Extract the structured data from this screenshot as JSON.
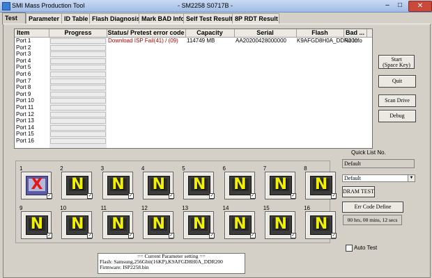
{
  "window": {
    "title": "SMI Mass Production Tool",
    "center_title": "- SM2258 S0717B -",
    "minimize": "–",
    "maximize": "□",
    "close": "✕"
  },
  "tabs": [
    "Test",
    "Parameter",
    "ID Table",
    "Flash Diagnosis",
    "Mark BAD Info",
    "Self Test Result",
    "8P RDT Result"
  ],
  "list": {
    "headers": [
      "Item",
      "Progress",
      "Status/ Pretest error code",
      "Capacity",
      "Serial",
      "Flash",
      "Bad ..."
    ],
    "rows": [
      {
        "item": "Port 1",
        "status": "Download ISP Fail(41) / (09)",
        "capacity": "114749 MB",
        "serial": "AA20200428000000",
        "flash": "K9AFGD8H0A_DDR200",
        "bad": "No Info"
      },
      {
        "item": "Port 2"
      },
      {
        "item": "Port 3"
      },
      {
        "item": "Port 4"
      },
      {
        "item": "Port 5"
      },
      {
        "item": "Port 6"
      },
      {
        "item": "Port 7"
      },
      {
        "item": "Port 8"
      },
      {
        "item": "Port 9"
      },
      {
        "item": "Port 10"
      },
      {
        "item": "Port 11"
      },
      {
        "item": "Port 12"
      },
      {
        "item": "Port 13"
      },
      {
        "item": "Port 14"
      },
      {
        "item": "Port 15"
      },
      {
        "item": "Port 16"
      }
    ]
  },
  "buttons": {
    "start_line1": "Start",
    "start_line2": "(Space Key)",
    "quit": "Quit",
    "scan_drive": "Scan Drive",
    "debug": "Debug",
    "dram_test": "DRAM TEST",
    "err_code_define": "Err Code Define"
  },
  "quick_list": {
    "label": "Quick List No.",
    "value": "Default",
    "combo_value": "Default"
  },
  "timer": "00 hrs, 00 mins, 12 secs",
  "auto_test_label": "Auto Test",
  "ports": [
    {
      "num": "1",
      "state": "X"
    },
    {
      "num": "2",
      "state": "N"
    },
    {
      "num": "3",
      "state": "N"
    },
    {
      "num": "4",
      "state": "N"
    },
    {
      "num": "5",
      "state": "N"
    },
    {
      "num": "6",
      "state": "N"
    },
    {
      "num": "7",
      "state": "N"
    },
    {
      "num": "8",
      "state": "N"
    },
    {
      "num": "9",
      "state": "N"
    },
    {
      "num": "10",
      "state": "N"
    },
    {
      "num": "11",
      "state": "N"
    },
    {
      "num": "12",
      "state": "N"
    },
    {
      "num": "13",
      "state": "N"
    },
    {
      "num": "14",
      "state": "N"
    },
    {
      "num": "15",
      "state": "N"
    },
    {
      "num": "16",
      "state": "N"
    }
  ],
  "param": {
    "header": "== Current Parameter setting ==",
    "flash": "Flash:  Samsung,256Gbit(16KP),K9AFGD8H0A_DDR200",
    "firmware": "Firmware:   ISP2258.bin"
  }
}
